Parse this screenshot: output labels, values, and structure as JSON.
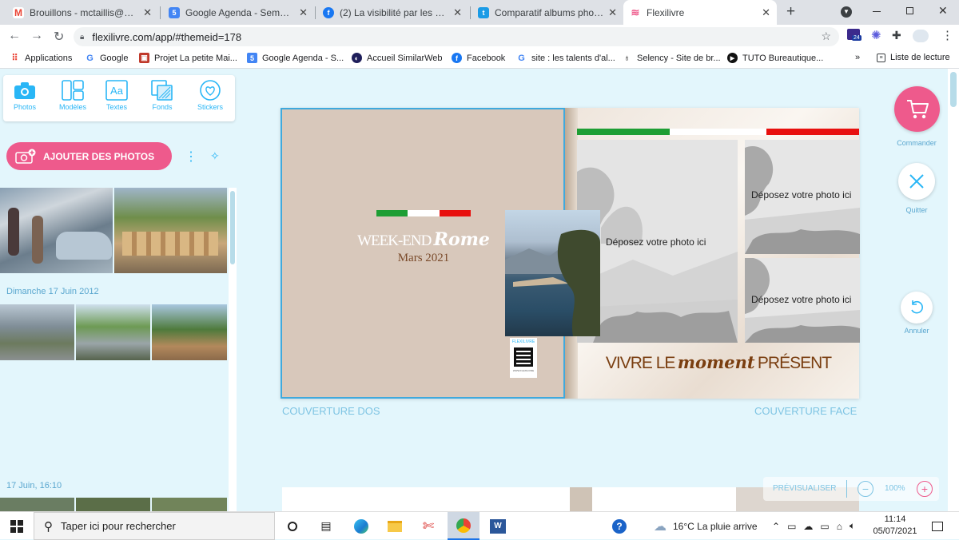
{
  "browser": {
    "tabs": [
      {
        "title": "Brouillons - mctaillis@gmail.c",
        "icon": "gmail-icon",
        "color": "#ea4335",
        "glyph": "M"
      },
      {
        "title": "Google Agenda - Semaine du",
        "icon": "google-calendar-icon",
        "color": "#4285f4",
        "glyph": "5"
      },
      {
        "title": "(2) La visibilité par les mots -",
        "icon": "facebook-icon",
        "color": "#1877f2",
        "glyph": "f"
      },
      {
        "title": "Comparatif albums photos 20",
        "icon": "bookmark-site-icon",
        "color": "#1a9be6",
        "glyph": "t"
      },
      {
        "title": "Flexilivre",
        "icon": "flexilivre-icon",
        "color": "#ee5a8c",
        "glyph": "≋"
      }
    ],
    "new_tab_glyph": "+",
    "url": "flexilivre.com/app/#themeid=178",
    "extension_badge": "24",
    "bookmarks": [
      {
        "label": "Applications",
        "color": "#4285f4",
        "glyph": "⋮"
      },
      {
        "label": "Google",
        "color": "#ffffff",
        "glyph": "G"
      },
      {
        "label": "Projet La petite Mai...",
        "color": "#c0392b",
        "glyph": "▣"
      },
      {
        "label": "Google Agenda - S...",
        "color": "#4285f4",
        "glyph": "5"
      },
      {
        "label": "Accueil SimilarWeb",
        "color": "#1e1e5a",
        "glyph": "◐"
      },
      {
        "label": "Facebook",
        "color": "#1877f2",
        "glyph": "f"
      },
      {
        "label": "site : les talents d'al...",
        "color": "#ffffff",
        "glyph": "G"
      },
      {
        "label": "Selency - Site de br...",
        "color": "#ffffff",
        "glyph": "♁"
      },
      {
        "label": "TUTO Bureautique...",
        "color": "#111111",
        "glyph": "▶"
      }
    ],
    "more_glyph": "»",
    "reading_list": "Liste de lecture"
  },
  "toolbar": {
    "items": [
      {
        "label": "Photos",
        "icon": "camera-icon"
      },
      {
        "label": "Modèles",
        "icon": "templates-icon"
      },
      {
        "label": "Textes",
        "icon": "text-icon"
      },
      {
        "label": "Fonds",
        "icon": "backgrounds-icon"
      },
      {
        "label": "Stickers",
        "icon": "heart-icon"
      }
    ]
  },
  "sidebar": {
    "add_photos": "AJOUTER DES PHOTOS",
    "dates": [
      "Dimanche 17 Juin 2012",
      "17 Juin, 16:10"
    ]
  },
  "book": {
    "back": {
      "title_left": "WEEK-END",
      "title_right": "Rome",
      "subtitle": "Mars 2021",
      "logo": "FLEXILIVRE",
      "qr_caption": "WWW.FLEXILIVRE"
    },
    "front": {
      "drop_label": "Déposez votre photo ici",
      "motto_pre": "VIVRE LE",
      "motto_mid": "moment",
      "motto_post": "PRÉSENT"
    },
    "label_back": "COUVERTURE DOS",
    "label_front": "COUVERTURE FACE"
  },
  "actions": {
    "order": "Commander",
    "quit": "Quitter",
    "undo": "Annuler",
    "preview": "PRÉVISUALISER",
    "zoom": "100%",
    "zoom_out": "−",
    "zoom_in": "+"
  },
  "taskbar": {
    "search_placeholder": "Taper ici pour rechercher",
    "weather": "16°C  La pluie arrive",
    "time": "11:14",
    "date": "05/07/2021"
  },
  "colors": {
    "accent_pink": "#ee5a8c",
    "accent_blue": "#29b6f6",
    "flag_green": "#1e9e34",
    "flag_red": "#e8100e"
  }
}
